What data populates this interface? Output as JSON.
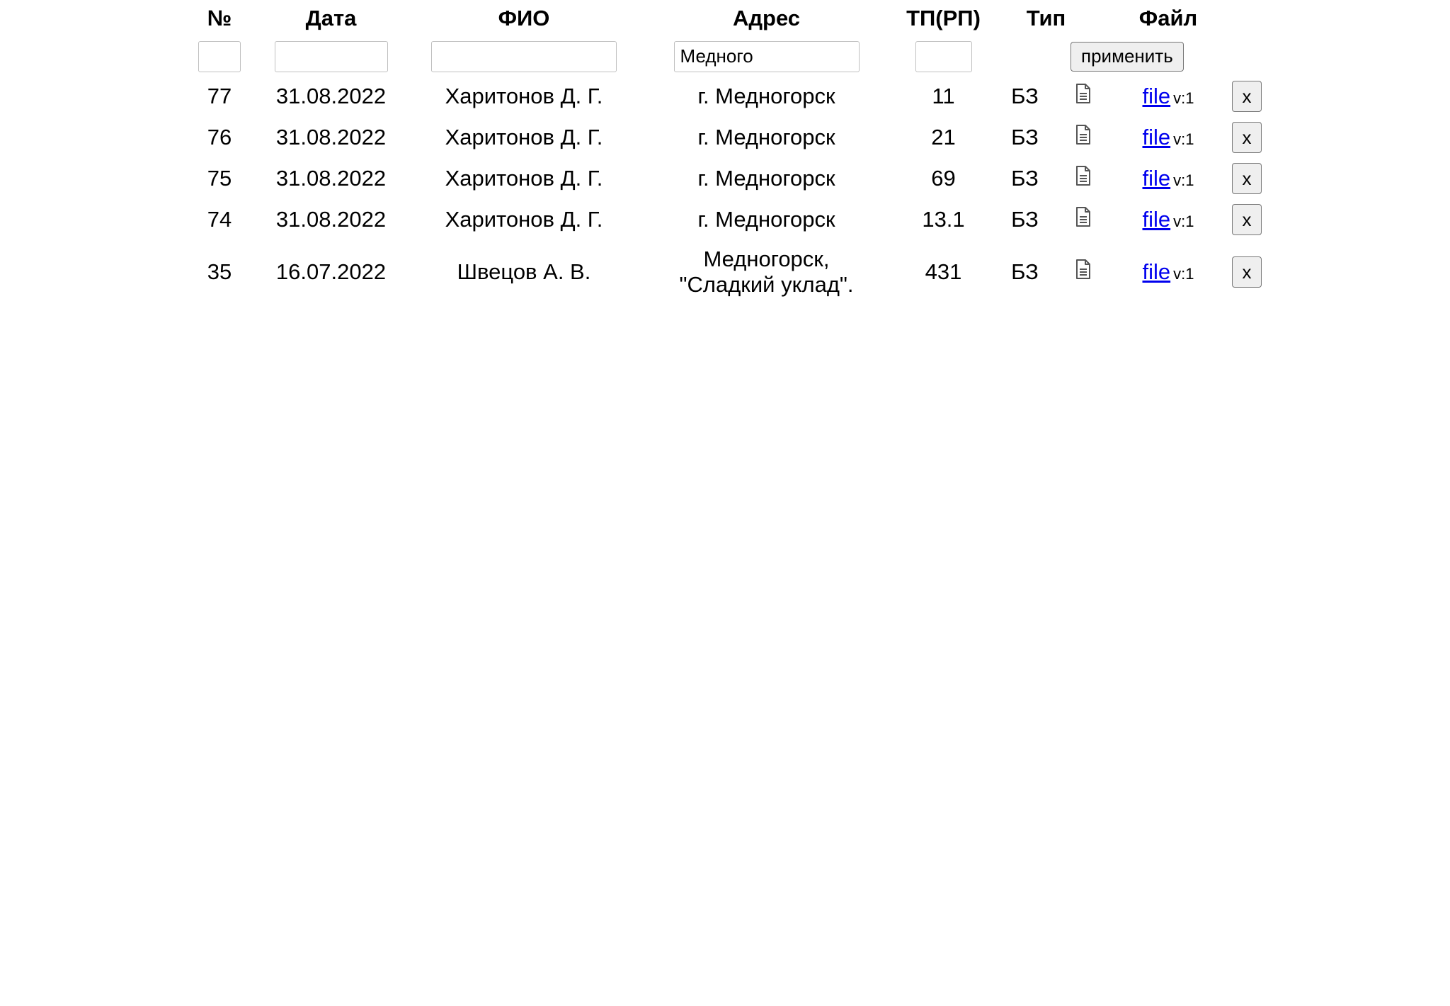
{
  "headers": {
    "number": "№",
    "date": "Дата",
    "fio": "ФИО",
    "address": "Адрес",
    "tp": "ТП(РП)",
    "type": "Тип",
    "file": "Файл"
  },
  "filters": {
    "number": "",
    "date": "",
    "fio": "",
    "address": "Медного",
    "tp": "",
    "apply_label": "применить"
  },
  "rows": [
    {
      "number": "77",
      "date": "31.08.2022",
      "fio": "Харитонов Д. Г.",
      "address_line1": "г. Медногорск",
      "address_line2": "",
      "tp": "11",
      "type": "БЗ",
      "file_link": "file",
      "version": "v:1",
      "delete_label": "x"
    },
    {
      "number": "76",
      "date": "31.08.2022",
      "fio": "Харитонов Д. Г.",
      "address_line1": "г. Медногорск",
      "address_line2": "",
      "tp": "21",
      "type": "БЗ",
      "file_link": "file",
      "version": "v:1",
      "delete_label": "x"
    },
    {
      "number": "75",
      "date": "31.08.2022",
      "fio": "Харитонов Д. Г.",
      "address_line1": "г. Медногорск",
      "address_line2": "",
      "tp": "69",
      "type": "БЗ",
      "file_link": "file",
      "version": "v:1",
      "delete_label": "x"
    },
    {
      "number": "74",
      "date": "31.08.2022",
      "fio": "Харитонов Д. Г.",
      "address_line1": "г. Медногорск",
      "address_line2": "",
      "tp": "13.1",
      "type": "БЗ",
      "file_link": "file",
      "version": "v:1",
      "delete_label": "x"
    },
    {
      "number": "35",
      "date": "16.07.2022",
      "fio": "Швецов А. В.",
      "address_line1": "Медногорск,",
      "address_line2": "\"Сладкий уклад\".",
      "tp": "431",
      "type": "БЗ",
      "file_link": "file",
      "version": "v:1",
      "delete_label": "x"
    }
  ],
  "icons": {
    "row_document": "document-icon"
  }
}
